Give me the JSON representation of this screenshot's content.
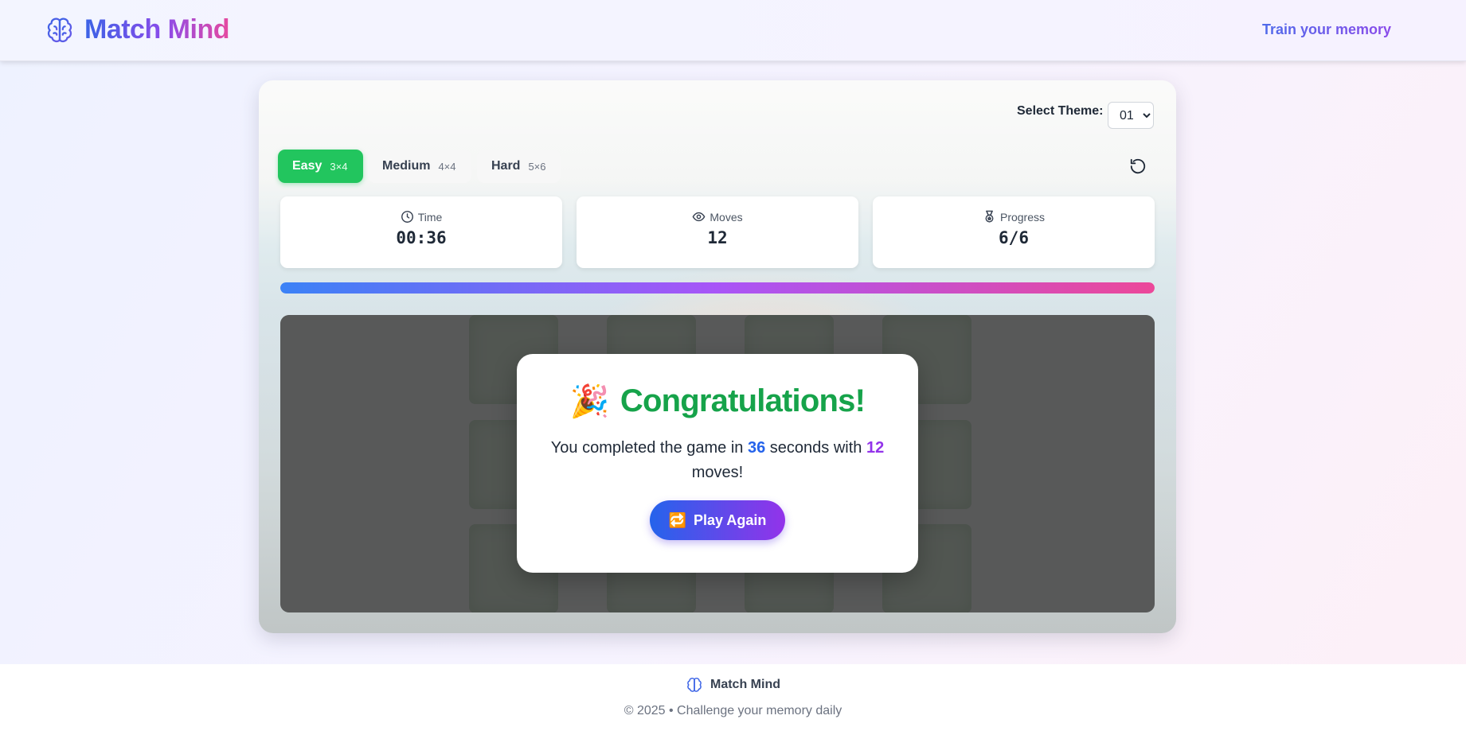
{
  "header": {
    "logo_icon": "brain-icon",
    "brand": "Match Mind",
    "tagline": "Train your memory"
  },
  "theme": {
    "label": "Select Theme:",
    "selected": "01"
  },
  "difficulty": [
    {
      "label": "Easy",
      "size": "3×4",
      "active": true
    },
    {
      "label": "Medium",
      "size": "4×4",
      "active": false
    },
    {
      "label": "Hard",
      "size": "5×6",
      "active": false
    }
  ],
  "reset_icon": "rotate-ccw-icon",
  "stats": {
    "time": {
      "label": "Time",
      "value": "00:36",
      "icon": "clock-icon"
    },
    "moves": {
      "label": "Moves",
      "value": "12",
      "icon": "eye-icon"
    },
    "progress": {
      "label": "Progress",
      "value": "6/6",
      "icon": "medal-icon"
    }
  },
  "progress_fraction": 1.0,
  "colors": {
    "accent_green": "#22c55e",
    "accent_blue": "#2563eb",
    "accent_purple": "#9333ea",
    "accent_pink": "#ec4899"
  },
  "modal": {
    "emoji": "🎉",
    "title": "Congratulations!",
    "msg_prefix": "You completed the game in",
    "seconds": "36",
    "msg_middle": "seconds with",
    "moves": "12",
    "msg_suffix": "moves!",
    "button_icon": "🔁",
    "button_label": "Play Again"
  },
  "footer": {
    "brand": "Match Mind",
    "copyright": "© 2025 • Challenge your memory daily"
  }
}
